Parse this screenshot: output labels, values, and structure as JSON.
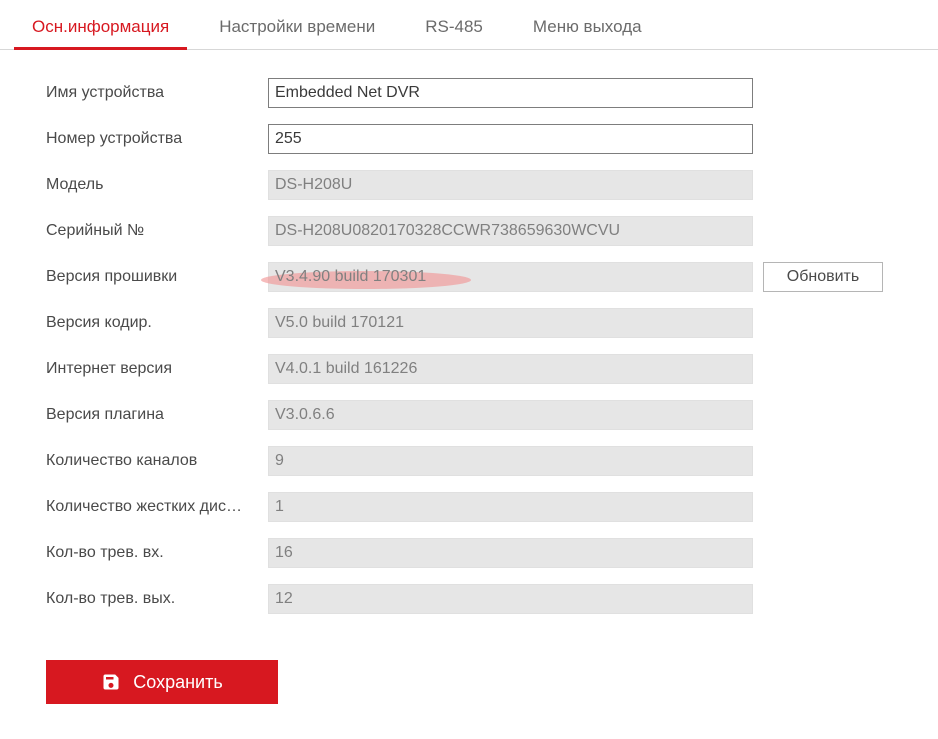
{
  "tabs": {
    "basic": "Осн.информация",
    "time": "Настройки времени",
    "rs485": "RS-485",
    "logout": "Меню выхода"
  },
  "labels": {
    "device_name": "Имя устройства",
    "device_no": "Номер устройства",
    "model": "Модель",
    "serial": "Серийный №",
    "firmware": "Версия прошивки",
    "encoding": "Версия кодир.",
    "web": "Интернет версия",
    "plugin": "Версия плагина",
    "channels": "Количество каналов",
    "hdds": "Количество жестких дис…",
    "alarm_in": "Кол-во трев. вх.",
    "alarm_out": "Кол-во трев. вых."
  },
  "values": {
    "device_name": "Embedded Net DVR",
    "device_no": "255",
    "model": "DS-H208U",
    "serial": "DS-H208U0820170328CCWR738659630WCVU",
    "firmware": "V3.4.90 build 170301",
    "encoding": "V5.0 build 170121",
    "web": "V4.0.1 build 161226",
    "plugin": "V3.0.6.6",
    "channels": "9",
    "hdds": "1",
    "alarm_in": "16",
    "alarm_out": "12"
  },
  "buttons": {
    "update": "Обновить",
    "save": "Сохранить"
  }
}
